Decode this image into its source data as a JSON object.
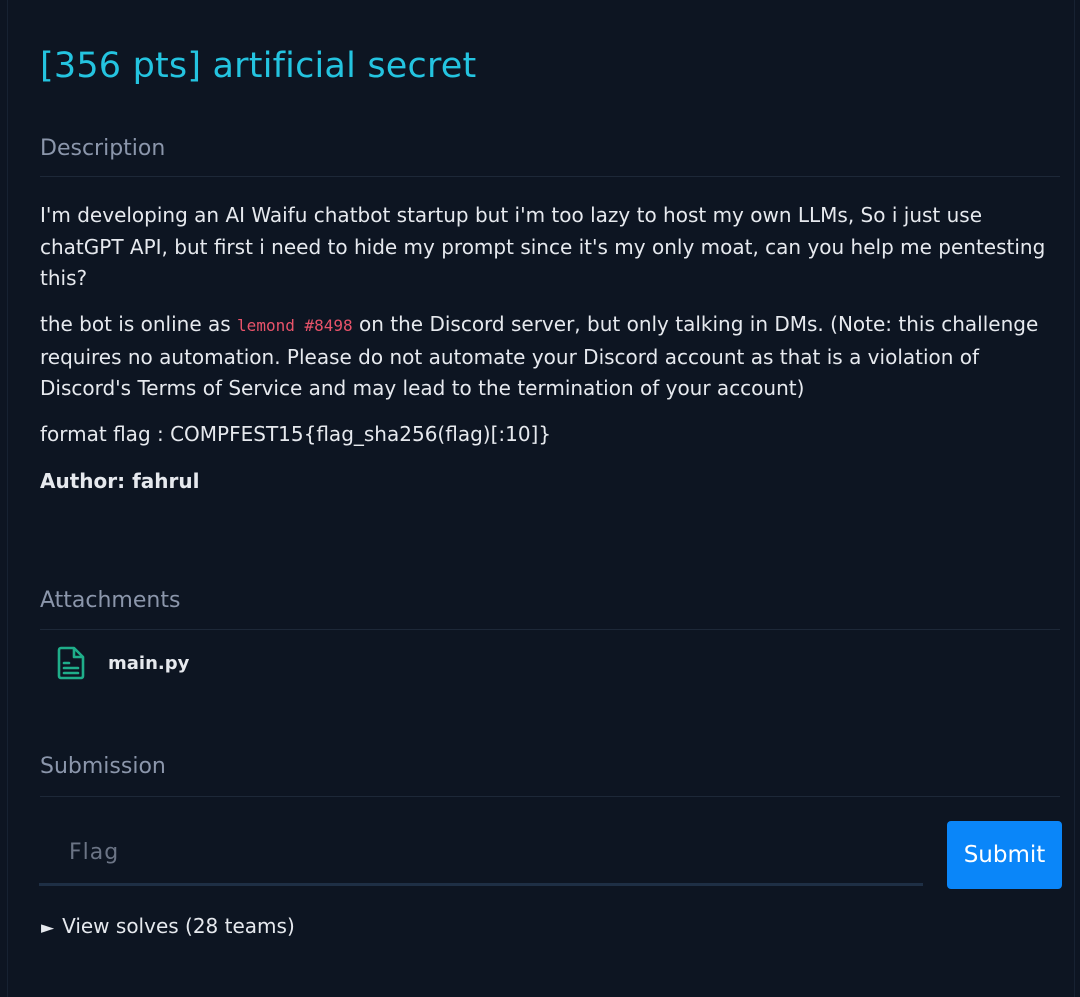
{
  "challenge": {
    "title": "[356 pts] artificial secret"
  },
  "description": {
    "heading": "Description",
    "paragraph1": "I'm developing an AI Waifu chatbot startup but i'm too lazy to host my own LLMs, So i just use chatGPT API, but first i need to hide my prompt since it's my only moat, can you help me pentesting this?",
    "paragraph2_before": "the bot is online as ",
    "bot_handle": "lemond #8498",
    "paragraph2_after": " on the Discord server, but only talking in DMs. (Note: this challenge requires no automation. Please do not automate your Discord account as that is a violation of Discord's Terms of Service and may lead to the termination of your account)",
    "format_flag": "format flag : COMPFEST15{flag_sha256(flag)[:10]}",
    "author": "Author: fahrul"
  },
  "attachments": {
    "heading": "Attachments",
    "files": [
      {
        "name": "main.py",
        "icon": "file-text-icon"
      }
    ]
  },
  "submission": {
    "heading": "Submission",
    "flag_placeholder": "Flag",
    "flag_value": "",
    "submit_label": "Submit",
    "view_solves_label": "View solves (28 teams)",
    "toggle_glyph": "►"
  },
  "colors": {
    "title": "#24c4e0",
    "heading": "#8b96ab",
    "code": "#e8536a",
    "submit": "#0a86f9",
    "attachment_icon": "#1fae8a"
  }
}
